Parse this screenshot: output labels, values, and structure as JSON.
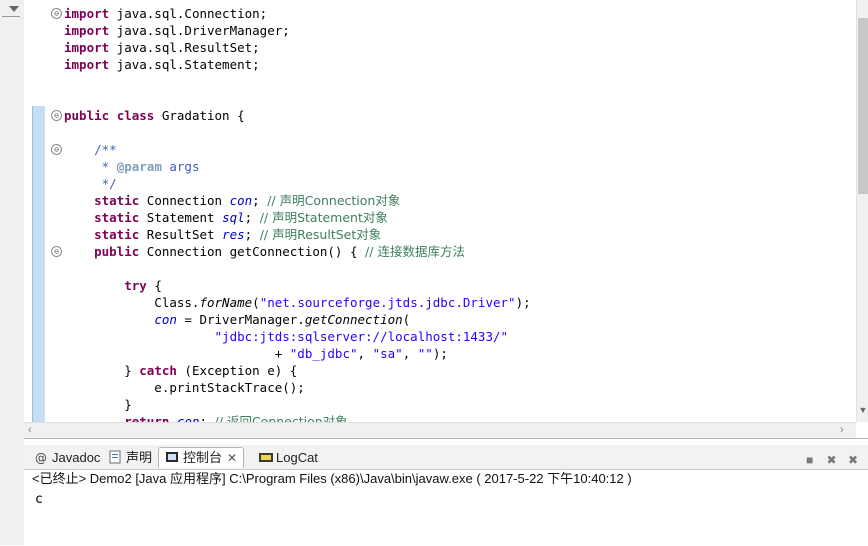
{
  "editor": {
    "lines": [
      [
        {
          "c": "kw",
          "t": "import"
        },
        {
          "c": "",
          "t": " java.sql.Connection;"
        }
      ],
      [
        {
          "c": "kw",
          "t": "import"
        },
        {
          "c": "",
          "t": " java.sql.DriverManager;"
        }
      ],
      [
        {
          "c": "kw",
          "t": "import"
        },
        {
          "c": "",
          "t": " java.sql.ResultSet;"
        }
      ],
      [
        {
          "c": "kw",
          "t": "import"
        },
        {
          "c": "",
          "t": " java.sql.Statement;"
        }
      ],
      [],
      [],
      [
        {
          "c": "kw",
          "t": "public"
        },
        {
          "c": "",
          "t": " "
        },
        {
          "c": "kw",
          "t": "class"
        },
        {
          "c": "",
          "t": " Gradation {"
        }
      ],
      [],
      [
        {
          "c": "",
          "t": "    "
        },
        {
          "c": "jdoc",
          "t": "/**"
        }
      ],
      [
        {
          "c": "",
          "t": "     "
        },
        {
          "c": "jdoc",
          "t": "* "
        },
        {
          "c": "tag",
          "t": "@param"
        },
        {
          "c": "jdoc",
          "t": " args"
        }
      ],
      [
        {
          "c": "",
          "t": "     "
        },
        {
          "c": "jdoc",
          "t": "*/"
        }
      ],
      [
        {
          "c": "",
          "t": "    "
        },
        {
          "c": "kw",
          "t": "static"
        },
        {
          "c": "",
          "t": " Connection "
        },
        {
          "c": "field",
          "t": "con"
        },
        {
          "c": "",
          "t": "; "
        },
        {
          "c": "cmt",
          "t": "// 声明Connection对象"
        }
      ],
      [
        {
          "c": "",
          "t": "    "
        },
        {
          "c": "kw",
          "t": "static"
        },
        {
          "c": "",
          "t": " Statement "
        },
        {
          "c": "field",
          "t": "sql"
        },
        {
          "c": "",
          "t": "; "
        },
        {
          "c": "cmt",
          "t": "// 声明Statement对象"
        }
      ],
      [
        {
          "c": "",
          "t": "    "
        },
        {
          "c": "kw",
          "t": "static"
        },
        {
          "c": "",
          "t": " ResultSet "
        },
        {
          "c": "field",
          "t": "res"
        },
        {
          "c": "",
          "t": "; "
        },
        {
          "c": "cmt",
          "t": "// 声明ResultSet对象"
        }
      ],
      [
        {
          "c": "",
          "t": "    "
        },
        {
          "c": "kw",
          "t": "public"
        },
        {
          "c": "",
          "t": " Connection getConnection() { "
        },
        {
          "c": "cmt",
          "t": "// 连接数据库方法"
        }
      ],
      [],
      [
        {
          "c": "",
          "t": "        "
        },
        {
          "c": "kw",
          "t": "try"
        },
        {
          "c": "",
          "t": " {"
        }
      ],
      [
        {
          "c": "",
          "t": "            Class."
        },
        {
          "c": "ital",
          "t": "forName"
        },
        {
          "c": "",
          "t": "("
        },
        {
          "c": "str",
          "t": "\"net.sourceforge.jtds.jdbc.Driver\""
        },
        {
          "c": "",
          "t": ");"
        }
      ],
      [
        {
          "c": "",
          "t": "            "
        },
        {
          "c": "field",
          "t": "con"
        },
        {
          "c": "",
          "t": " = DriverManager."
        },
        {
          "c": "ital",
          "t": "getConnection"
        },
        {
          "c": "",
          "t": "("
        }
      ],
      [
        {
          "c": "",
          "t": "                    "
        },
        {
          "c": "str",
          "t": "\"jdbc:jtds:sqlserver://localhost:1433/\""
        }
      ],
      [
        {
          "c": "",
          "t": "                            + "
        },
        {
          "c": "str",
          "t": "\"db_jdbc\""
        },
        {
          "c": "",
          "t": ", "
        },
        {
          "c": "str",
          "t": "\"sa\""
        },
        {
          "c": "",
          "t": ", "
        },
        {
          "c": "str",
          "t": "\"\""
        },
        {
          "c": "",
          "t": ");"
        }
      ],
      [
        {
          "c": "",
          "t": "        } "
        },
        {
          "c": "kw",
          "t": "catch"
        },
        {
          "c": "",
          "t": " (Exception e) {"
        }
      ],
      [
        {
          "c": "",
          "t": "            e.printStackTrace();"
        }
      ],
      [
        {
          "c": "",
          "t": "        }"
        }
      ],
      [
        {
          "c": "",
          "t": "        "
        },
        {
          "c": "kw",
          "t": "return"
        },
        {
          "c": "",
          "t": " "
        },
        {
          "c": "field",
          "t": "con"
        },
        {
          "c": "",
          "t": "; "
        },
        {
          "c": "cmt",
          "t": "// 返回Connection对象"
        }
      ]
    ]
  },
  "panel": {
    "tabs": [
      {
        "label": "Javadoc",
        "icon": "javadoc-icon"
      },
      {
        "label": "声明",
        "icon": "declaration-icon"
      },
      {
        "label": "控制台",
        "icon": "console-icon",
        "active": true
      },
      {
        "label": "LogCat",
        "icon": "logcat-icon"
      }
    ],
    "status": "<已终止> Demo2 [Java 应用程序] C:\\Program Files (x86)\\Java\\bin\\javaw.exe ( 2017-5-22 下午10:40:12 )",
    "console_output": "c"
  },
  "colors": {
    "keyword": "#7f0055",
    "string": "#2a00ff",
    "comment": "#3f7f5f",
    "javadoc": "#3f5fbf",
    "field": "#0000c0"
  }
}
